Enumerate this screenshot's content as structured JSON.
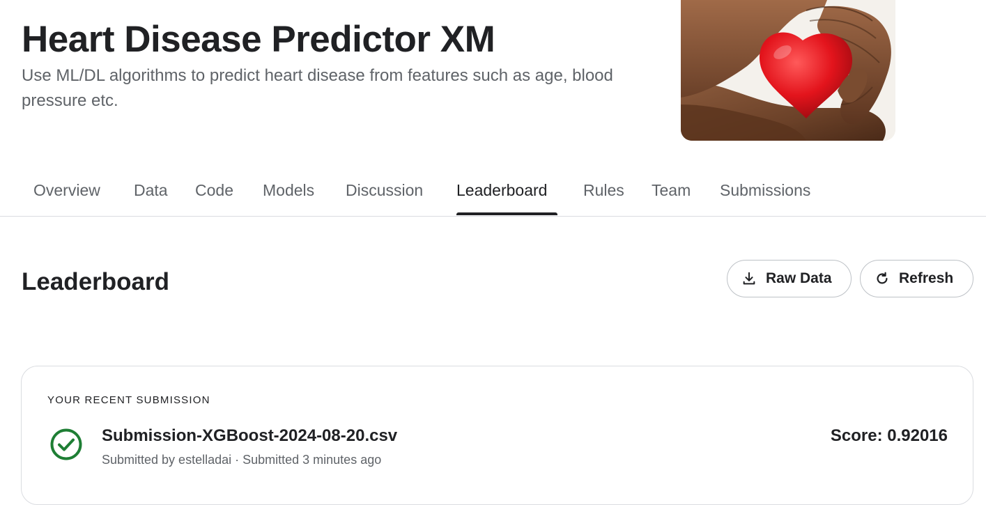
{
  "header": {
    "title": "Heart Disease Predictor XM",
    "subtitle": "Use ML/DL algorithms to predict heart disease from features such as age, blood pressure etc.",
    "banner_image": "hands-holding-red-heart"
  },
  "tabs": [
    {
      "label": "Overview",
      "active": false
    },
    {
      "label": "Data",
      "active": false
    },
    {
      "label": "Code",
      "active": false
    },
    {
      "label": "Models",
      "active": false
    },
    {
      "label": "Discussion",
      "active": false
    },
    {
      "label": "Leaderboard",
      "active": true
    },
    {
      "label": "Rules",
      "active": false
    },
    {
      "label": "Team",
      "active": false
    },
    {
      "label": "Submissions",
      "active": false
    }
  ],
  "leaderboard": {
    "title": "Leaderboard",
    "raw_data_label": "Raw Data",
    "raw_data_icon": "download-icon",
    "refresh_label": "Refresh",
    "refresh_icon": "refresh-icon"
  },
  "recent_submission": {
    "label": "YOUR RECENT SUBMISSION",
    "status_icon": "check-circle-icon",
    "status_color": "#1e7e34",
    "file_name": "Submission-XGBoost-2024-08-20.csv",
    "submitted_line": "Submitted by estelladai · Submitted 3 minutes ago",
    "score_text": "Score: 0.92016"
  }
}
